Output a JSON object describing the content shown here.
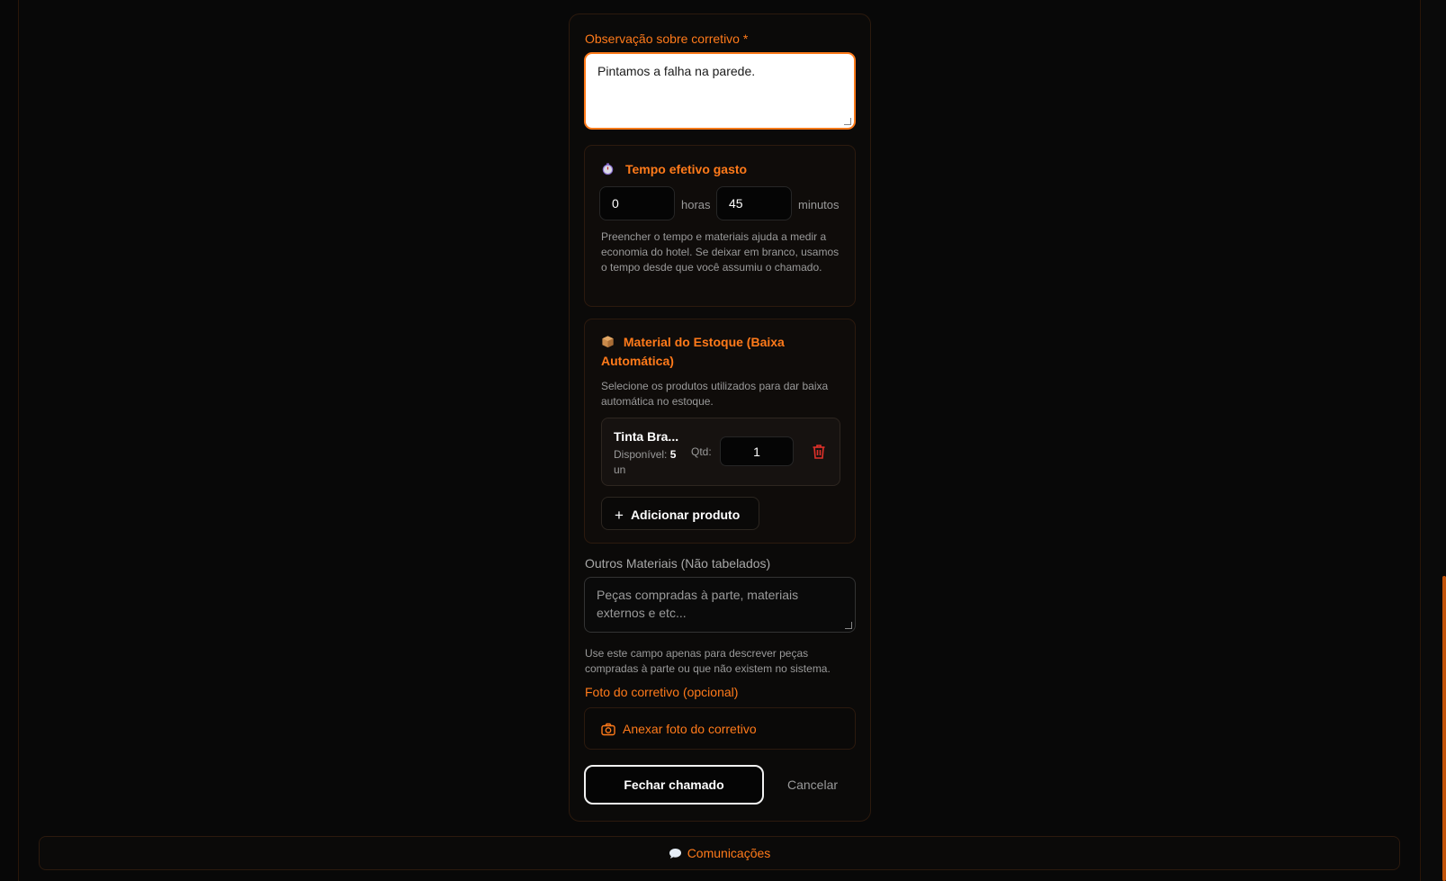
{
  "form": {
    "observation_label": "Observação sobre corretivo *",
    "observation_value": "Pintamos a falha na parede.",
    "time_section": {
      "title": "Tempo efetivo gasto",
      "hours_value": "0",
      "hours_unit": "horas",
      "minutes_value": "45",
      "minutes_unit": "minutos",
      "help": "Preencher o tempo e materiais ajuda a medir a economia do hotel. Se deixar em branco, usamos o tempo desde que você assumiu o chamado."
    },
    "stock_section": {
      "title": "Material do Estoque (Baixa Automática)",
      "help": "Selecione os produtos utilizados para dar baixa automática no estoque.",
      "product": {
        "name": "Tinta Bra...",
        "available_label": "Disponível:",
        "available_value": "5",
        "available_unit": "un",
        "qty_label": "Qtd:",
        "qty_value": "1"
      },
      "add_button": "Adicionar produto"
    },
    "other_materials": {
      "label": "Outros Materiais (Não tabelados)",
      "placeholder": "Peças compradas à parte, materiais externos e etc...",
      "help": "Use este campo apenas para descrever peças compradas à parte ou que não existem no sistema."
    },
    "photo": {
      "label": "Foto do corretivo (opcional)",
      "button": "Anexar foto do corretivo"
    },
    "actions": {
      "close": "Fechar chamado",
      "cancel": "Cancelar"
    }
  },
  "communications": {
    "label": "Comunicações"
  },
  "colors": {
    "accent": "#ff7a1a",
    "background": "#070707",
    "danger": "#e0312a"
  }
}
